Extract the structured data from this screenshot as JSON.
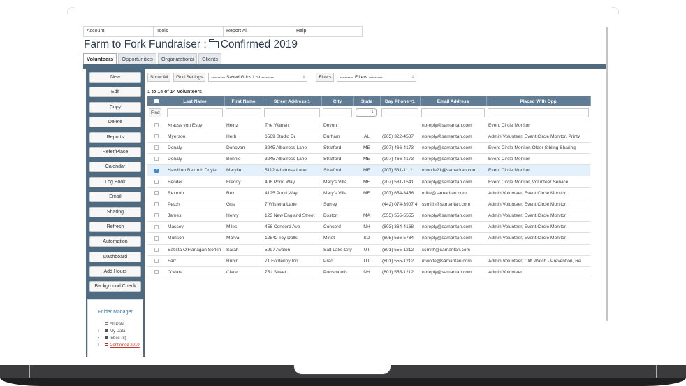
{
  "menu": [
    "Account",
    "Tools",
    "Report All",
    "Help"
  ],
  "title": {
    "prefix": "Farm to Fork Fundraiser :",
    "folder": "Confirmed 2019"
  },
  "tabs": [
    {
      "label": "Volunteers",
      "active": true
    },
    {
      "label": "Opportunities",
      "active": false
    },
    {
      "label": "Organizations",
      "active": false
    },
    {
      "label": "Clients",
      "active": false
    }
  ],
  "sidebar": {
    "buttons": [
      "New",
      "Edit",
      "Copy",
      "Delete",
      "Reports",
      "Refer/Place",
      "Calendar",
      "Log Book",
      "Email",
      "Sharing",
      "Refresh",
      "Automation",
      "Dashboard",
      "Add Hours",
      "Background Check"
    ],
    "folder_manager": {
      "title": "Folder Manager",
      "items": [
        "All Data",
        "My Data",
        "Inbox (8)",
        "Confirmed 2019"
      ]
    }
  },
  "toolbar": {
    "show_all": "Show All",
    "grid_settings": "Grid Settings",
    "saved_grids": "--------- Saved Grids List --------",
    "filters_button": "Filters",
    "filters_select": "--------- Filters ---------"
  },
  "record_count": "1 to 14 of 14 Volunteers",
  "table": {
    "columns": [
      "Last Name",
      "First Name",
      "Street Address 1",
      "City",
      "State",
      "Day Phone ▾1",
      "Email Address",
      "Placed With Opp"
    ],
    "find_label": "Find",
    "rows": [
      {
        "last": "Krauss von Espy",
        "first": "Heinz",
        "street": "The Warren",
        "city": "Devon",
        "state": "",
        "phone": "",
        "email": "noreply@samaritan.com",
        "placed": "Event Circle Monitor",
        "selected": false
      },
      {
        "last": "Myerson",
        "first": "Herb",
        "street": "6589 Studio Dr",
        "city": "Durham",
        "state": "AL",
        "phone": "(205) 322-4587",
        "email": "noreply@samaritan.com",
        "placed": "Admin Volunteer, Event Circle Monitor, Printv",
        "selected": false
      },
      {
        "last": "Donaly",
        "first": "Donovan",
        "street": "3245 Albatross Lane",
        "city": "Stratford",
        "state": "ME",
        "phone": "(207) 466-4173",
        "email": "noreply@samaritan.com",
        "placed": "Event Circle Monitor, Older Sibling Sharing",
        "selected": false
      },
      {
        "last": "Donaly",
        "first": "Bonnie",
        "street": "3245 Albatross Lane",
        "city": "Stratford",
        "state": "ME",
        "phone": "(207) 466-4173",
        "email": "noreply@samaritan.com",
        "placed": "Event Circle Monitor",
        "selected": false
      },
      {
        "last": "Hamilton Rexroth Doyle",
        "first": "Marylin",
        "street": "5112 Albatross Lane",
        "city": "Stratford",
        "state": "ME",
        "phone": "(207) 531-1111",
        "email": "mwolfe21@samaritan.com",
        "placed": "Event Circle Monitor",
        "selected": true
      },
      {
        "last": "Bender",
        "first": "Freddy",
        "street": "406 Pond Way",
        "city": "Mary's Villa",
        "state": "ME",
        "phone": "(207) 581-1541",
        "email": "noreply@samaritan.com",
        "placed": "Event Circle Monitor, Volunteer Service",
        "selected": false
      },
      {
        "last": "Rexroth",
        "first": "Rex",
        "street": "4125 Pond Way",
        "city": "Mary's Villa",
        "state": "ME",
        "phone": "(207) 654-3456",
        "email": "mike@samaritan.com",
        "placed": "Admin Volunteer, Event Circle Monitor",
        "selected": false
      },
      {
        "last": "Petch",
        "first": "Gus",
        "street": "7 Wisteria Lane",
        "city": "Surrey",
        "state": "",
        "phone": "(442) 074-3907 4",
        "email": "ssmith@samaritan.com",
        "placed": "Admin Volunteer, Event Circle Monitor",
        "selected": false
      },
      {
        "last": "James",
        "first": "Henry",
        "street": "123 New England Street",
        "city": "Boston",
        "state": "MA",
        "phone": "(555) 555-5555",
        "email": "noreply@samaritan.com",
        "placed": "Admin Volunteer, Event Circle Monitor",
        "selected": false
      },
      {
        "last": "Massey",
        "first": "Miles",
        "street": "456 Concord Ave",
        "city": "Concord",
        "state": "NH",
        "phone": "(603) 364-4168",
        "email": "noreply@samaritan.com",
        "placed": "Admin Volunteer, Event Circle Monitor",
        "selected": false
      },
      {
        "last": "Munson",
        "first": "Marva",
        "street": "12842 Toy Dolls",
        "city": "Minot",
        "state": "SD",
        "phone": "(605) 566-5784",
        "email": "noreply@samaritan.com",
        "placed": "Admin Volunteer, Event Circle Monitor",
        "selected": false
      },
      {
        "last": "Batista O'Flanagan Sorkin",
        "first": "Sarah",
        "street": "5997 Avalon",
        "city": "Salt Lake City",
        "state": "UT",
        "phone": "(801) 555-1212",
        "email": "ssmith@samaritan.com",
        "placed": "",
        "selected": false
      },
      {
        "last": "Farr",
        "first": "Rubin",
        "street": "71 Fontenoy Inn",
        "city": "Prad",
        "state": "UT",
        "phone": "(801) 555-1212",
        "email": "mwolfe@samaritan.com",
        "placed": "Admin Volunteer, Cliff  Watch - Prevention, Re",
        "selected": false
      },
      {
        "last": "O'Mara",
        "first": "Clare",
        "street": "75 I Street",
        "city": "Portsmouth",
        "state": "NH",
        "phone": "(801) 555-1212",
        "email": "noreply@samaritan.com",
        "placed": "Admin Volunteer",
        "selected": false
      }
    ]
  },
  "colors": {
    "accent": "#4f6b82",
    "header": "#627c93",
    "selected_row": "#e4f0fb",
    "title": "#2b3b4f"
  }
}
